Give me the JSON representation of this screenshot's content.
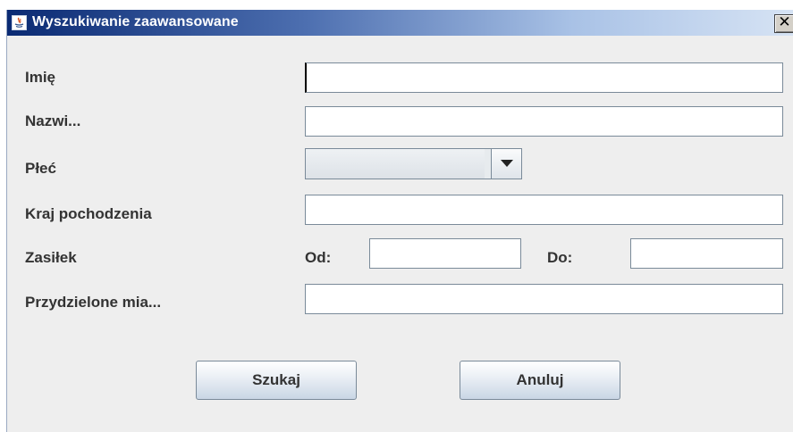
{
  "window": {
    "title": "Wyszukiwanie zaawansowane",
    "close_glyph": "✕"
  },
  "form": {
    "imie_label": "Imię",
    "imie_value": "",
    "nazwisko_label": "Nazwi...",
    "nazwisko_value": "",
    "plec_label": "Płeć",
    "plec_value": "",
    "kraj_label": "Kraj pochodzenia",
    "kraj_value": "",
    "zasilek_label": "Zasiłek",
    "od_label": "Od:",
    "od_value": "",
    "do_label": "Do:",
    "do_value": "",
    "przydzielone_label": "Przydzielone mia...",
    "przydzielone_value": ""
  },
  "buttons": {
    "search_label": "Szukaj",
    "cancel_label": "Anuluj"
  },
  "icons": {
    "app": "java-icon",
    "close": "close-icon",
    "dropdown": "chevron-down-icon"
  },
  "colors": {
    "titlebar_dark": "#0a2a73",
    "titlebar_light": "#d6e3f4",
    "dialog_bg": "#eeeeee"
  }
}
